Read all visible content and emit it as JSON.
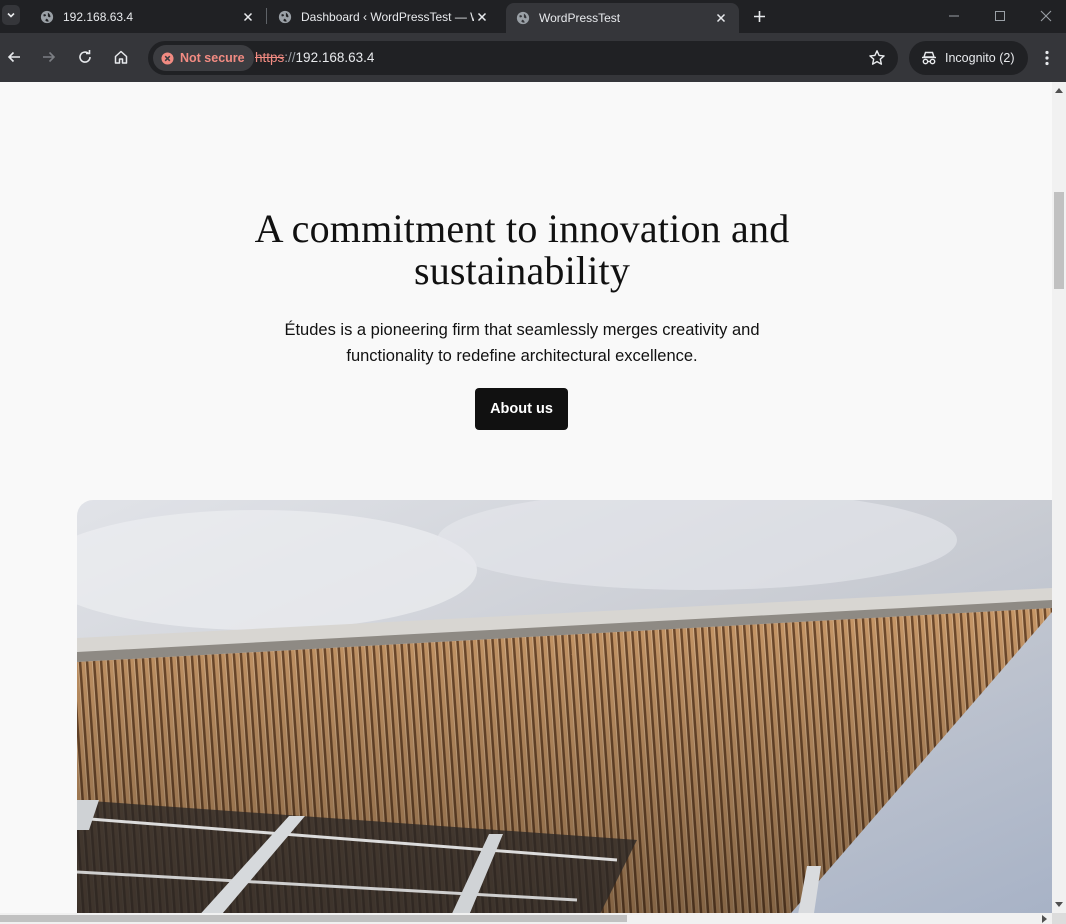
{
  "browser": {
    "tabs": [
      {
        "title": "192.168.63.4",
        "active": false
      },
      {
        "title": "Dashboard ‹ WordPressTest — W",
        "active": false
      },
      {
        "title": "WordPressTest",
        "active": true
      }
    ],
    "address_bar": {
      "security_label": "Not secure",
      "url_scheme": "https",
      "url_separator": "://",
      "url_host": "192.168.63.4"
    },
    "incognito_label": "Incognito (2)",
    "icons": {
      "tab_favicon": "globe-icon",
      "back": "arrow-left-icon",
      "forward": "arrow-right-icon",
      "reload": "reload-icon",
      "home": "home-icon",
      "security": "warning-circle-icon",
      "bookmark": "star-icon",
      "incognito": "incognito-icon",
      "menu": "kebab-menu-icon"
    },
    "colors": {
      "chrome_dark": "#202124",
      "chrome_toolbar": "#35363a",
      "warning_red": "#f28b82"
    }
  },
  "page": {
    "heading_line1": "A commitment to innovation and",
    "heading_line2": "sustainability",
    "description_line1": "Études is a pioneering firm that seamlessly merges creativity and",
    "description_line2": "functionality to redefine architectural excellence.",
    "cta_label": "About us",
    "colors": {
      "background": "#f9f9f9",
      "text": "#111111",
      "button_bg": "#111111",
      "button_text": "#ffffff"
    }
  }
}
